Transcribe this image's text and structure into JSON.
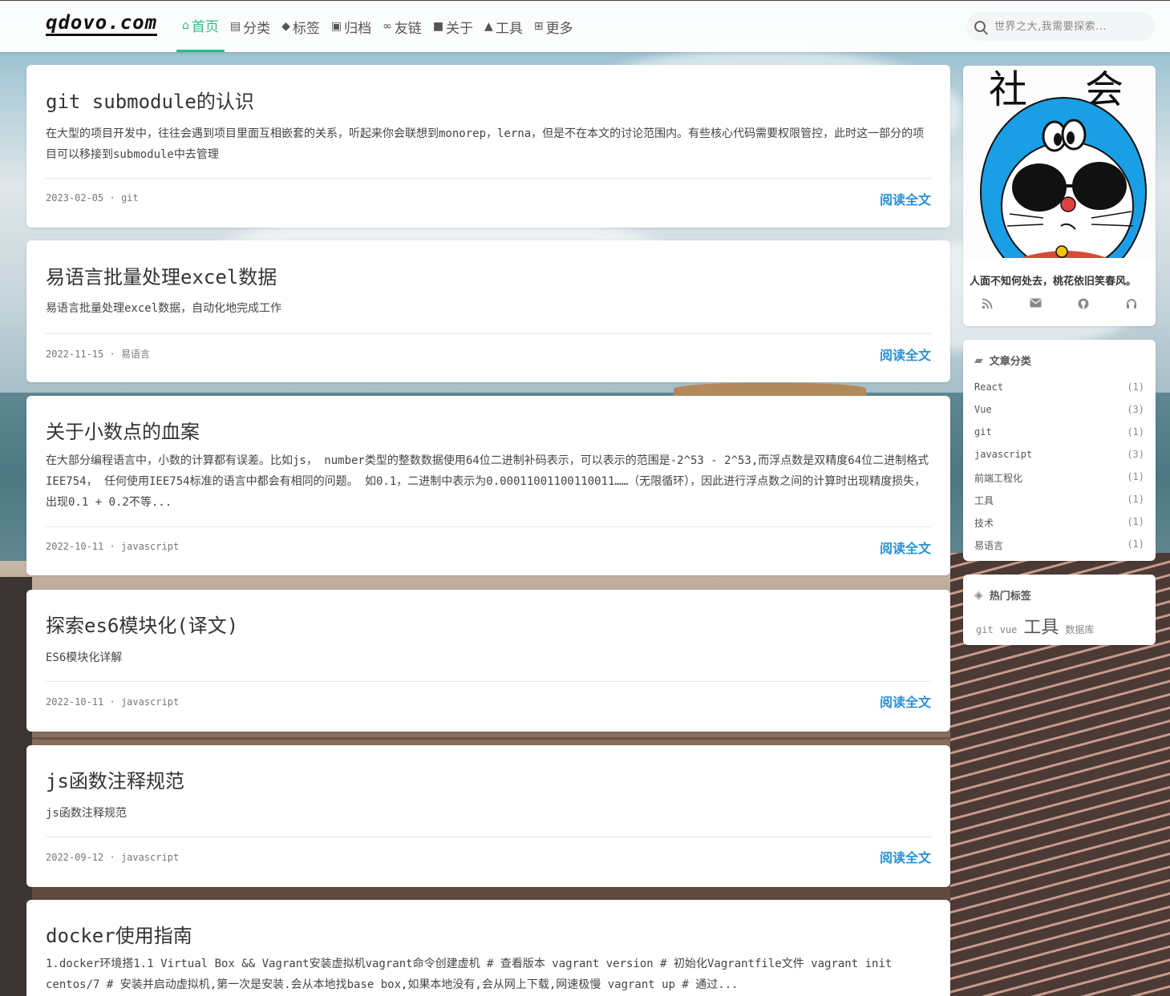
{
  "site": {
    "logo": "qdovo.com"
  },
  "nav": [
    {
      "icon": "home-icon",
      "glyph": "⌂",
      "label": "首页",
      "active": true
    },
    {
      "icon": "folder-icon",
      "glyph": "▤",
      "label": "分类"
    },
    {
      "icon": "tag-icon",
      "glyph": "◆",
      "label": "标签"
    },
    {
      "icon": "archive-icon",
      "glyph": "▣",
      "label": "归档"
    },
    {
      "icon": "link-icon",
      "glyph": "∞",
      "label": "友链"
    },
    {
      "icon": "comment-icon",
      "glyph": "■",
      "label": "关于"
    },
    {
      "icon": "flask-icon",
      "glyph": "▲",
      "label": "工具"
    },
    {
      "icon": "grid-icon",
      "glyph": "⊞",
      "label": "更多"
    }
  ],
  "search": {
    "placeholder": "世界之大,我需要探索..."
  },
  "posts": [
    {
      "title": "git submodule的认识",
      "excerpt": "在大型的项目开发中，往往会遇到项目里面互相嵌套的关系，听起来你会联想到monorep，lerna，但是不在本文的讨论范围内。有些核心代码需要权限管控，此时这一部分的项目可以移接到submodule中去管理",
      "date": "2023-02-05",
      "category": "git",
      "read_more": "阅读全文"
    },
    {
      "title": "易语言批量处理excel数据",
      "excerpt": "易语言批量处理excel数据，自动化地完成工作",
      "date": "2022-11-15",
      "category": "易语言",
      "read_more": "阅读全文"
    },
    {
      "title": "关于小数点的血案",
      "excerpt": "在大部分编程语言中，小数的计算都有误差。比如js， number类型的整数数据使用64位二进制补码表示，可以表示的范围是-2^53 - 2^53,而浮点数是双精度64位二进制格式 IEE754， 任何使用IEE754标准的语言中都会有相同的问题。 如0.1，二进制中表示为0.00011001100110011……（无限循环），因此进行浮点数之间的计算时出现精度损失，出现0.1 + 0.2不等...",
      "date": "2022-10-11",
      "category": "javascript",
      "read_more": "阅读全文"
    },
    {
      "title": "探索es6模块化(译文)",
      "excerpt": "ES6模块化详解",
      "date": "2022-10-11",
      "category": "javascript",
      "read_more": "阅读全文"
    },
    {
      "title": "js函数注释规范",
      "excerpt": "js函数注释规范",
      "date": "2022-09-12",
      "category": "javascript",
      "read_more": "阅读全文"
    },
    {
      "title": "docker使用指南",
      "excerpt": "1.docker环境搭1.1 Virtual Box && Vagrant安装虚拟机vagrant命令创建虚机 # 查看版本 vagrant version # 初始化Vagrantfile文件 vagrant init centos/7 # 安装并启动虚拟机,第一次是安装.会从本地找base box,如果本地没有,会从网上下载,网速极慢 vagrant up # 通过...",
      "date": "",
      "category": "",
      "read_more": ""
    }
  ],
  "profile": {
    "avatar_text_left": "社",
    "avatar_text_right": "会",
    "motto": "人面不知何处去，桃花依旧笑春风。",
    "social": [
      "rss-icon",
      "envelope-icon",
      "github-icon",
      "headphones-icon"
    ]
  },
  "categories": {
    "title": "文章分类",
    "items": [
      {
        "name": "React",
        "count": "(1)"
      },
      {
        "name": "Vue",
        "count": "(3)"
      },
      {
        "name": "git",
        "count": "(1)"
      },
      {
        "name": "javascript",
        "count": "(3)"
      },
      {
        "name": "前端工程化",
        "count": "(1)"
      },
      {
        "name": "工具",
        "count": "(1)"
      },
      {
        "name": "技术",
        "count": "(1)"
      },
      {
        "name": "易语言",
        "count": "(1)"
      }
    ]
  },
  "tags": {
    "title": "热门标签",
    "items": [
      {
        "name": "git",
        "weight": 1
      },
      {
        "name": "vue",
        "weight": 1
      },
      {
        "name": "工具",
        "weight": 3
      },
      {
        "name": "数据库",
        "weight": 1
      }
    ]
  },
  "colors": {
    "accent": "#2bbc8a",
    "link": "#2a8fd6"
  }
}
